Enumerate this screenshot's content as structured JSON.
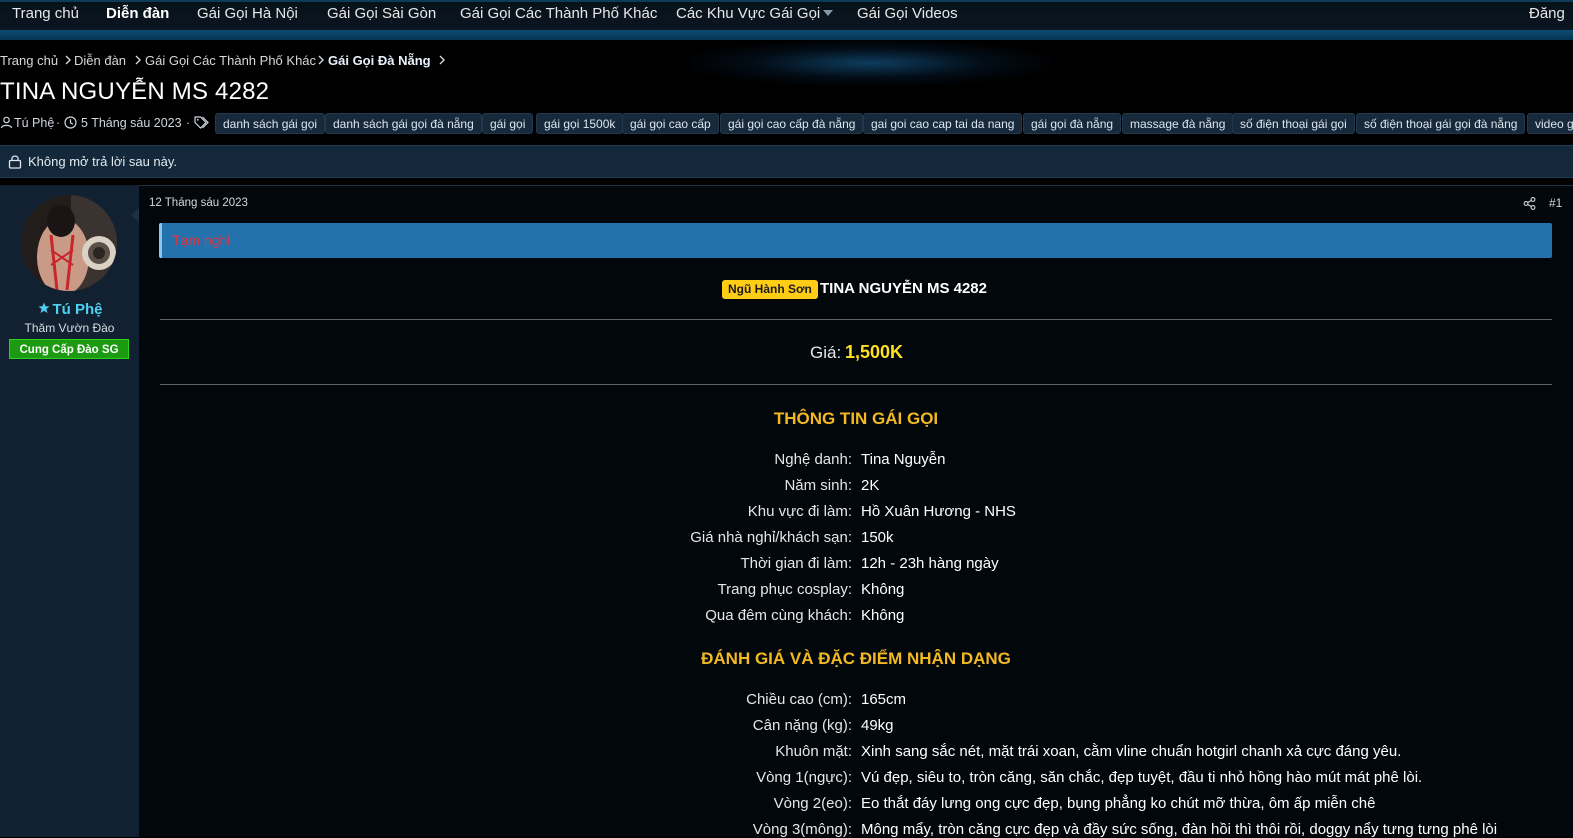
{
  "nav": {
    "items": [
      {
        "label": "Trang chủ"
      },
      {
        "label": "Diễn đàn",
        "active": true
      },
      {
        "label": "Gái Gọi Hà Nội"
      },
      {
        "label": "Gái Gọi Sài Gòn"
      },
      {
        "label": "Gái Gọi Các Thành Phố Khác"
      },
      {
        "label": "Các Khu Vực Gái Gọi"
      },
      {
        "label": "Gái Gọi Videos"
      }
    ],
    "right_label": "Đăng"
  },
  "breadcrumb": [
    "Trang chủ",
    "Diễn đàn",
    "Gái Gọi Các Thành Phố Khác",
    "Gái Gọi Đà Nẵng"
  ],
  "thread": {
    "title": "TINA NGUYỄN MS 4282",
    "author": "Tú Phệ",
    "date": "5 Tháng sáu 2023",
    "tags": [
      "danh sách gái gọi",
      "danh sách gái gọi đà nẵng",
      "gái gọi",
      "gái gọi 1500k",
      "gái gọi cao cấp",
      "gái gọi cao cấp đà nẵng",
      "gai goi cao cap tai da nang",
      "gái gọi đà nẵng",
      "massage đà nẵng",
      "số điện thoại gái gọi",
      "số điện thoại gái gọi đà nẵng",
      "video g"
    ],
    "locked_notice": "Không mở trả lời sau này."
  },
  "user": {
    "name": "Tú Phệ",
    "title": "Thăm Vườn Đào",
    "banner": "Cung Cấp Đào SG"
  },
  "post": {
    "date": "12 Tháng sáu 2023",
    "number": "#1",
    "status": "Tạm nghỉ",
    "area_badge": "Ngũ Hành Sơn",
    "headline": "TINA NGUYỄN MS 4282",
    "price_label": "Giá:",
    "price_value": "1,500K",
    "info_title": "THÔNG TIN GÁI GỌI",
    "info": [
      {
        "label": "Nghệ danh:",
        "value": "Tina Nguyễn"
      },
      {
        "label": "Năm sinh:",
        "value": "2K"
      },
      {
        "label": "Khu vực đi làm:",
        "value": "Hồ Xuân Hương - NHS"
      },
      {
        "label": "Giá nhà nghỉ/khách sạn:",
        "value": "150k"
      },
      {
        "label": "Thời gian đi làm:",
        "value": "12h - 23h hàng ngày"
      },
      {
        "label": "Trang phục cosplay:",
        "value": "Không"
      },
      {
        "label": "Qua đêm cùng khách:",
        "value": "Không"
      }
    ],
    "review_title": "ĐÁNH GIÁ VÀ ĐẶC ĐIỂM NHẬN DẠNG",
    "review": [
      {
        "label": "Chiều cao (cm):",
        "value": "165cm"
      },
      {
        "label": "Cân nặng (kg):",
        "value": "49kg"
      },
      {
        "label": "Khuôn mặt:",
        "value": "Xinh sang sắc nét, mặt trái xoan, cằm vline chuẩn hotgirl chanh xả cực đáng yêu."
      },
      {
        "label": "Vòng 1(ngực):",
        "value": "Vú đẹp, siêu to, tròn căng, săn chắc, đẹp tuyệt, đầu ti nhỏ hồng hào mút mát phê lòi."
      },
      {
        "label": "Vòng 2(eo):",
        "value": "Eo thắt đáy lưng ong cực đẹp, bụng phẳng ko chút mỡ thừa, ôm ấp miễn chê"
      },
      {
        "label": "Vòng 3(mông):",
        "value": "Mông mẩy, tròn căng cực đẹp và đầy sức sống, đàn hồi thì thôi rồi, doggy nẩy tưng tưng phê lòi"
      }
    ]
  },
  "colors": {
    "accent": "#2372ad",
    "price": "#ffe020",
    "section": "#f3b923",
    "username": "#4fd0f0",
    "status": "#e0353f",
    "banner": "#1c9a12"
  }
}
